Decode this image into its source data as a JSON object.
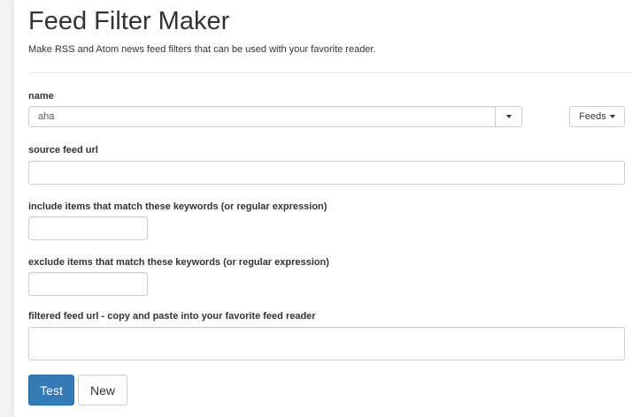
{
  "header": {
    "title": "Feed Filter Maker",
    "subtitle": "Make RSS and Atom news feed filters that can be used with your favorite reader."
  },
  "form": {
    "name": {
      "label": "name",
      "value": "aha"
    },
    "feeds_button": {
      "label": "Feeds"
    },
    "source_feed_url": {
      "label": "source feed url",
      "value": ""
    },
    "include_keywords": {
      "label": "include items that match these keywords (or regular expression)",
      "value": ""
    },
    "exclude_keywords": {
      "label": "exclude items that match these keywords (or regular expression)",
      "value": ""
    },
    "filtered_feed_url": {
      "label": "filtered feed url - copy and paste into your favorite feed reader",
      "value": ""
    }
  },
  "actions": {
    "test_label": "Test",
    "new_label": "New"
  },
  "colors": {
    "primary": "#337ab7",
    "border": "#cccccc",
    "text": "#333333"
  }
}
